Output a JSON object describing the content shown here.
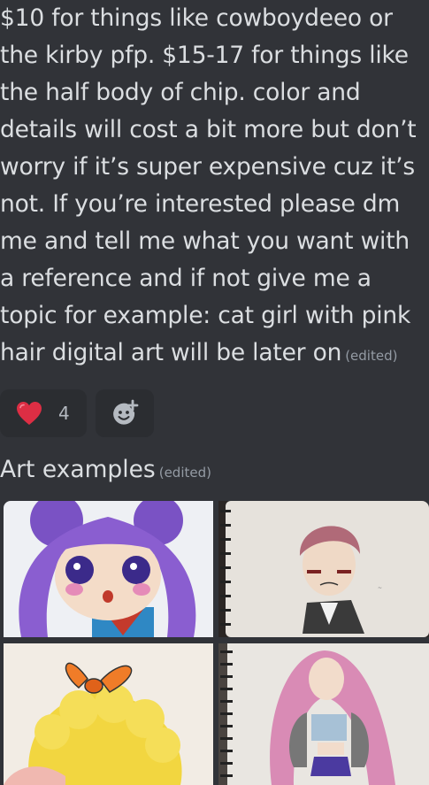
{
  "message": {
    "lines": [
      "$10 for things like cowboydeeo or",
      "the kirby pfp.  $15-17 for things like",
      "the half body of chip.  color and",
      "details will cost a bit more but don’t",
      "worry if it’s super expensive cuz it’s",
      "not. If you’re interested please dm",
      "me and tell me what you want with",
      "a reference and if not give me a",
      "topic for example: cat girl with pink",
      "hair digital art will be later on"
    ],
    "edited_label": "(edited)"
  },
  "reactions": {
    "heart": {
      "emoji": "❤️",
      "count": "4",
      "icon": "heart-icon"
    },
    "add_reaction_icon": "add-reaction-icon"
  },
  "art_section": {
    "title": "Art examples",
    "edited_label": "(edited)"
  },
  "images": [
    {
      "subject": "purple-haired chibi drawing"
    },
    {
      "subject": "sketchbook drawing of boy with face paint"
    },
    {
      "subject": "yellow-haired character with orange bow"
    },
    {
      "subject": "sketchbook drawing of pink-haired girl"
    }
  ],
  "colors": {
    "background": "#313338",
    "text": "#dbdee1",
    "muted": "#949ba4",
    "reaction_bg": "#2b2d31",
    "heart": "#dd2e44"
  }
}
